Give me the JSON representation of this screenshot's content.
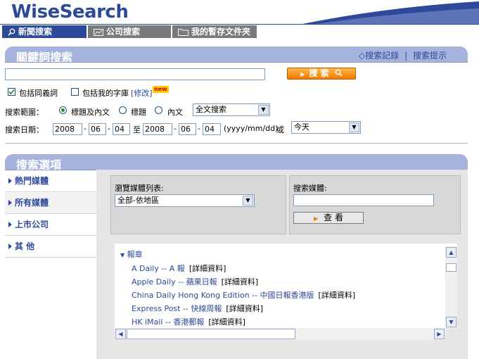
{
  "header": {
    "logo": "WiseSearch",
    "tabs": [
      "新聞搜索",
      "公司搜索",
      "我的暫存文件夾"
    ]
  },
  "keyword_section": {
    "title": "關鍵詞搜索",
    "links": [
      "搜索記錄",
      "搜索提示"
    ],
    "link_sep": "|",
    "search_input": "",
    "search_button": "搜 索",
    "checkbox_synonyms": "包括同義詞",
    "checkbox_mydict": "包括我的字庫",
    "modify_link": "[修改]",
    "new_badge": "new",
    "scope_label": "搜索範圍：",
    "scope_options": [
      "標題及內文",
      "標題",
      "內文"
    ],
    "scope_select": "全文搜索",
    "date_label": "搜索日期：",
    "from_year": "2008",
    "from_month": "06",
    "from_day": "04",
    "to_word": "至",
    "to_year": "2008",
    "to_month": "06",
    "to_day": "04",
    "date_format": "(yyyy/mm/dd)",
    "or_word": "或",
    "date_select": "今天",
    "dash": "-"
  },
  "options_section": {
    "title": "搜索選項",
    "nav": [
      "熱門媒體",
      "所有媒體",
      "上市公司",
      "其 他"
    ],
    "browse_label": "瀏覽媒體列表:",
    "browse_select": "全部-依地區",
    "search_media_label": "搜索媒體:",
    "search_media_input": "",
    "view_button": "查 看",
    "category": "報章",
    "media_list": [
      {
        "name": "A Daily -- A 報",
        "detail": "[詳細資料]"
      },
      {
        "name": "Apple Daily -- 蘋果日報",
        "detail": "[詳細資料]"
      },
      {
        "name": "China Daily Hong Kong Edition -- 中國日報香港版",
        "detail": "[詳細資料]"
      },
      {
        "name": "Express Post -- 快線周報",
        "detail": "[詳細資料]"
      },
      {
        "name": "HK iMail -- 香港郵報",
        "detail": "[詳細資料]"
      }
    ]
  },
  "colors": {
    "brand": "#2d4a9a",
    "section_bar": "#a6b3dc",
    "accent": "#f07a00"
  }
}
